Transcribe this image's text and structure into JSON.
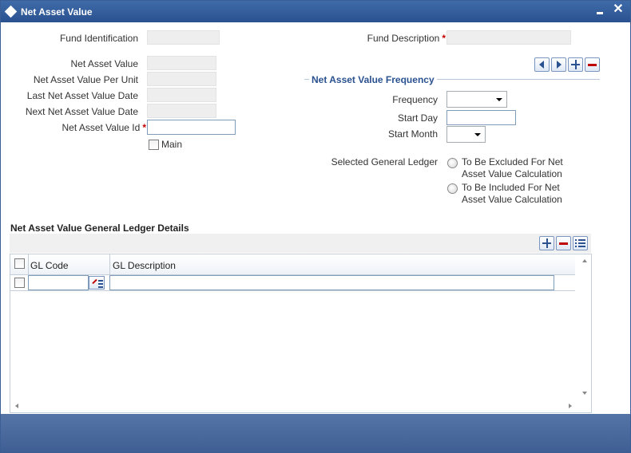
{
  "window": {
    "title": "Net Asset Value",
    "colors": {
      "titlebar": "#2a5190",
      "required": "#c00000",
      "footer": "#4a6aa0"
    }
  },
  "form": {
    "fund_identification": {
      "label": "Fund Identification",
      "value": ""
    },
    "fund_description": {
      "label": "Fund Description",
      "required_mark": "*",
      "value": ""
    },
    "net_asset_value": {
      "label": "Net Asset Value",
      "value": ""
    },
    "nav_per_unit": {
      "label": "Net Asset Value Per Unit",
      "value": ""
    },
    "last_nav_date": {
      "label": "Last Net Asset Value Date",
      "value": ""
    },
    "next_nav_date": {
      "label": "Next Net Asset Value Date",
      "value": ""
    },
    "nav_id": {
      "label": "Net Asset Value Id",
      "required_mark": "*",
      "value": ""
    },
    "main": {
      "label": "Main",
      "checked": false
    }
  },
  "frequency_section": {
    "title": "Net Asset Value Frequency",
    "frequency": {
      "label": "Frequency",
      "selected": ""
    },
    "start_day": {
      "label": "Start Day",
      "value": ""
    },
    "start_month": {
      "label": "Start Month",
      "selected": ""
    }
  },
  "ledger": {
    "label": "Selected General Ledger",
    "options": [
      {
        "line1": "To Be Excluded For Net",
        "line2": "Asset Value Calculation",
        "selected": false
      },
      {
        "line1": "To Be Included For Net",
        "line2": "Asset Value Calculation",
        "selected": false
      }
    ]
  },
  "grid": {
    "title": "Net Asset Value General Ledger Details",
    "columns": [
      "GL Code",
      "GL Description"
    ],
    "rows": [
      {
        "gl_code": "",
        "gl_description": ""
      }
    ]
  }
}
